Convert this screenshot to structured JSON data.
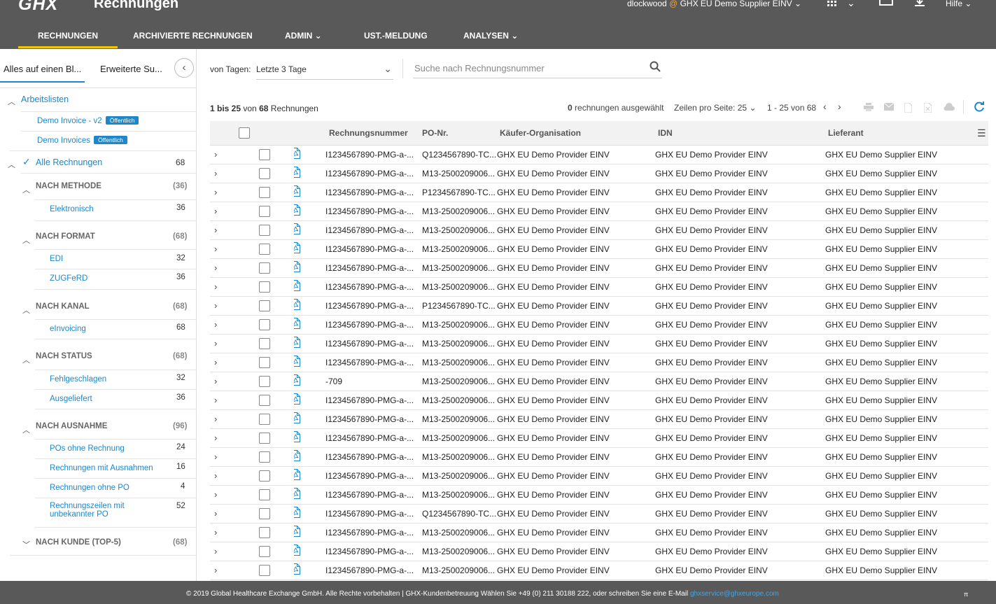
{
  "header": {
    "logo": "GHX",
    "title": "Rechnungen",
    "user": "dlockwood",
    "at": "@",
    "org": "GHX EU Demo Supplier EINV",
    "help": "Hilfe"
  },
  "nav": {
    "items": [
      "RECHNUNGEN",
      "ARCHIVIERTE RECHNUNGEN",
      "ADMIN",
      "UST.-MELDUNG",
      "ANALYSEN"
    ]
  },
  "sidebar": {
    "tabs": [
      "Alles auf einen Bl...",
      "Erweiterte Su..."
    ],
    "worklists_label": "Arbeitslisten",
    "worklists": [
      {
        "label": "Demo Invoice - v2",
        "badge": "Öffentlich"
      },
      {
        "label": "Demo Invoices",
        "badge": "Öffentlich"
      }
    ],
    "all": {
      "label": "Alle Rechnungen",
      "count": "68"
    },
    "groups": [
      {
        "title": "NACH METHODE",
        "count": "(36)",
        "items": [
          {
            "label": "Elektronisch",
            "count": "36"
          }
        ]
      },
      {
        "title": "NACH FORMAT",
        "count": "(68)",
        "items": [
          {
            "label": "EDI",
            "count": "32"
          },
          {
            "label": "ZUGFeRD",
            "count": "36"
          }
        ]
      },
      {
        "title": "NACH KANAL",
        "count": "(68)",
        "items": [
          {
            "label": "eInvoicing",
            "count": "68"
          }
        ]
      },
      {
        "title": "NACH STATUS",
        "count": "(68)",
        "items": [
          {
            "label": "Fehlgeschlagen",
            "count": "32"
          },
          {
            "label": "Ausgeliefert",
            "count": "36"
          }
        ]
      },
      {
        "title": "NACH AUSNAHME",
        "count": "(96)",
        "items": [
          {
            "label": "POs ohne Rechnung",
            "count": "24"
          },
          {
            "label": "Rechnungen mit Ausnahmen",
            "count": "16"
          },
          {
            "label": "Rechnungen ohne PO",
            "count": "4"
          },
          {
            "label": "Rechnungszeilen mit",
            "label2": "unbekannter PO",
            "count": "52"
          }
        ]
      },
      {
        "title": "NACH KUNDE (TOP-5)",
        "count": "(68)",
        "items": []
      }
    ]
  },
  "filter": {
    "label": "von Tagen:",
    "value": "Letzte 3 Tage",
    "search_placeholder": "Suche nach Rechnungsnummer"
  },
  "summary": {
    "range": "1 bis 25",
    "of": "von",
    "total": "68",
    "suffix": "Rechnungen",
    "selected_count": "0",
    "selected_text": "rechnungen ausgewählt",
    "rows_per_page_label": "Zeilen pro Seite:",
    "rows_per_page": "25",
    "page_range": "1 - 25 von 68"
  },
  "table": {
    "columns": [
      "Rechnungsnummer",
      "PO-Nr.",
      "Käufer-Organisation",
      "IDN",
      "Lieferant"
    ],
    "rows": [
      [
        "I1234567890-PMG-a-...",
        "Q1234567890-TC...",
        "GHX EU Demo Provider EINV",
        "GHX EU Demo Provider EINV",
        "GHX EU Demo Supplier EINV"
      ],
      [
        "I1234567890-PMG-a-...",
        "M13-2500209006...",
        "GHX EU Demo Provider EINV",
        "GHX EU Demo Provider EINV",
        "GHX EU Demo Supplier EINV"
      ],
      [
        "I1234567890-PMG-a-...",
        "P1234567890-TC...",
        "GHX EU Demo Provider EINV",
        "GHX EU Demo Provider EINV",
        "GHX EU Demo Supplier EINV"
      ],
      [
        "I1234567890-PMG-a-...",
        "M13-2500209006...",
        "GHX EU Demo Provider EINV",
        "GHX EU Demo Provider EINV",
        "GHX EU Demo Supplier EINV"
      ],
      [
        "I1234567890-PMG-a-...",
        "M13-2500209006...",
        "GHX EU Demo Provider EINV",
        "GHX EU Demo Provider EINV",
        "GHX EU Demo Supplier EINV"
      ],
      [
        "I1234567890-PMG-a-...",
        "M13-2500209006...",
        "GHX EU Demo Provider EINV",
        "GHX EU Demo Provider EINV",
        "GHX EU Demo Supplier EINV"
      ],
      [
        "I1234567890-PMG-a-...",
        "M13-2500209006...",
        "GHX EU Demo Provider EINV",
        "GHX EU Demo Provider EINV",
        "GHX EU Demo Supplier EINV"
      ],
      [
        "I1234567890-PMG-a-...",
        "M13-2500209006...",
        "GHX EU Demo Provider EINV",
        "GHX EU Demo Provider EINV",
        "GHX EU Demo Supplier EINV"
      ],
      [
        "I1234567890-PMG-a-...",
        "P1234567890-TC...",
        "GHX EU Demo Provider EINV",
        "GHX EU Demo Provider EINV",
        "GHX EU Demo Supplier EINV"
      ],
      [
        "I1234567890-PMG-a-...",
        "M13-2500209006...",
        "GHX EU Demo Provider EINV",
        "GHX EU Demo Provider EINV",
        "GHX EU Demo Supplier EINV"
      ],
      [
        "I1234567890-PMG-a-...",
        "M13-2500209006...",
        "GHX EU Demo Provider EINV",
        "GHX EU Demo Provider EINV",
        "GHX EU Demo Supplier EINV"
      ],
      [
        "I1234567890-PMG-a-...",
        "M13-2500209006...",
        "GHX EU Demo Provider EINV",
        "GHX EU Demo Provider EINV",
        "GHX EU Demo Supplier EINV"
      ],
      [
        "-709",
        "M13-2500209006...",
        "GHX EU Demo Provider EINV",
        "GHX EU Demo Provider EINV",
        "GHX EU Demo Supplier EINV"
      ],
      [
        "I1234567890-PMG-a-...",
        "M13-2500209006...",
        "GHX EU Demo Provider EINV",
        "GHX EU Demo Provider EINV",
        "GHX EU Demo Supplier EINV"
      ],
      [
        "I1234567890-PMG-a-...",
        "M13-2500209006...",
        "GHX EU Demo Provider EINV",
        "GHX EU Demo Provider EINV",
        "GHX EU Demo Supplier EINV"
      ],
      [
        "I1234567890-PMG-a-...",
        "M13-2500209006...",
        "GHX EU Demo Provider EINV",
        "GHX EU Demo Provider EINV",
        "GHX EU Demo Supplier EINV"
      ],
      [
        "I1234567890-PMG-a-...",
        "M13-2500209006...",
        "GHX EU Demo Provider EINV",
        "GHX EU Demo Provider EINV",
        "GHX EU Demo Supplier EINV"
      ],
      [
        "I1234567890-PMG-a-...",
        "M13-2500209006...",
        "GHX EU Demo Provider EINV",
        "GHX EU Demo Provider EINV",
        "GHX EU Demo Supplier EINV"
      ],
      [
        "I1234567890-PMG-a-...",
        "M13-2500209006...",
        "GHX EU Demo Provider EINV",
        "GHX EU Demo Provider EINV",
        "GHX EU Demo Supplier EINV"
      ],
      [
        "I1234567890-PMG-a-...",
        "Q1234567890-TC...",
        "GHX EU Demo Provider EINV",
        "GHX EU Demo Provider EINV",
        "GHX EU Demo Supplier EINV"
      ],
      [
        "I1234567890-PMG-a-...",
        "M13-2500209006...",
        "GHX EU Demo Provider EINV",
        "GHX EU Demo Provider EINV",
        "GHX EU Demo Supplier EINV"
      ],
      [
        "I1234567890-PMG-a-...",
        "M13-2500209006...",
        "GHX EU Demo Provider EINV",
        "GHX EU Demo Provider EINV",
        "GHX EU Demo Supplier EINV"
      ],
      [
        "I1234567890-PMG-a-...",
        "M13-2500209006...",
        "GHX EU Demo Provider EINV",
        "GHX EU Demo Provider EINV",
        "GHX EU Demo Supplier EINV"
      ]
    ]
  },
  "footer": {
    "text": "© 2019 Global Healthcare Exchange GmbH. Alle Rechte vorbehalten | GHX-Kundenbetreuung Wählen Sie +49 (0) 211 30188 222, oder schreiben Sie eine E-Mail",
    "email": "ghxservice@ghxeurope.com",
    "pi": "π"
  },
  "colors": {
    "header_bg": "#595959",
    "accent": "#1d87c9",
    "nav_underline": "#f5c400",
    "user_at": "#f5a623"
  },
  "icons": [
    "apps-grid-icon",
    "monitor-icon",
    "download-icon",
    "search-icon",
    "pdf-icon",
    "print-icon",
    "mail-icon",
    "pdf-export-icon",
    "excel-icon",
    "cloud-download-icon",
    "refresh-icon",
    "column-menu-icon"
  ]
}
